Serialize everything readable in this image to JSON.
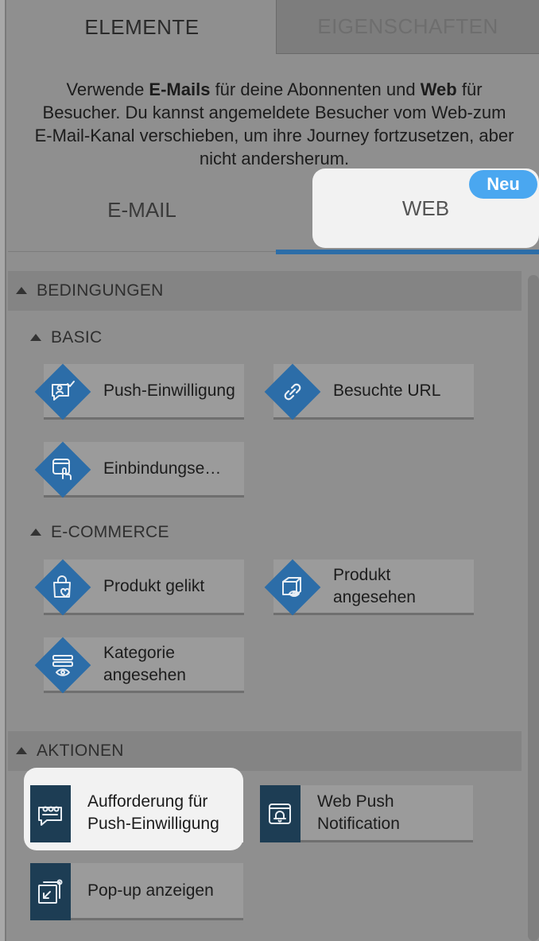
{
  "top_tabs": {
    "elements": "ELEMENTE",
    "properties": "EIGENSCHAFTEN"
  },
  "intro": {
    "p1": "Verwende ",
    "b1": "E-Mails",
    "p2": " für deine Abonnenten und ",
    "b2": "Web",
    "p3": " für Besucher. Du kannst angemeldete Besucher vom Web-zum E-Mail-Kanal verschieben, um ihre Journey fortzusetzen, aber nicht andersherum."
  },
  "channel_tabs": {
    "email": "E-MAIL",
    "web": "WEB",
    "new_badge": "Neu"
  },
  "colors": {
    "accent": "#2c6da8",
    "badge": "#4aa7f0",
    "action_icon_bg": "#1d3d54"
  },
  "conditions": {
    "title": "BEDINGUNGEN",
    "basic": {
      "title": "BASIC",
      "items": [
        {
          "label": "Push-Einwilligung",
          "icon": "chat-check-icon"
        },
        {
          "label": "Besuchte URL",
          "icon": "link-icon"
        },
        {
          "label": "Einbindungse…",
          "icon": "tap-window-icon"
        }
      ]
    },
    "ecommerce": {
      "title": "E-COMMERCE",
      "items": [
        {
          "label": "Produkt gelikt",
          "icon": "bag-heart-icon"
        },
        {
          "label": "Produkt angesehen",
          "icon": "box-eye-icon"
        },
        {
          "label": "Kategorie angesehen",
          "icon": "list-eye-icon"
        }
      ]
    }
  },
  "actions": {
    "title": "AKTIONEN",
    "items": [
      {
        "label": "Aufforderung für Push-Einwilligung",
        "icon": "push-prompt-icon"
      },
      {
        "label": "Web Push Notification",
        "icon": "bell-window-icon"
      },
      {
        "label": "Pop-up anzeigen",
        "icon": "popup-icon"
      }
    ]
  }
}
